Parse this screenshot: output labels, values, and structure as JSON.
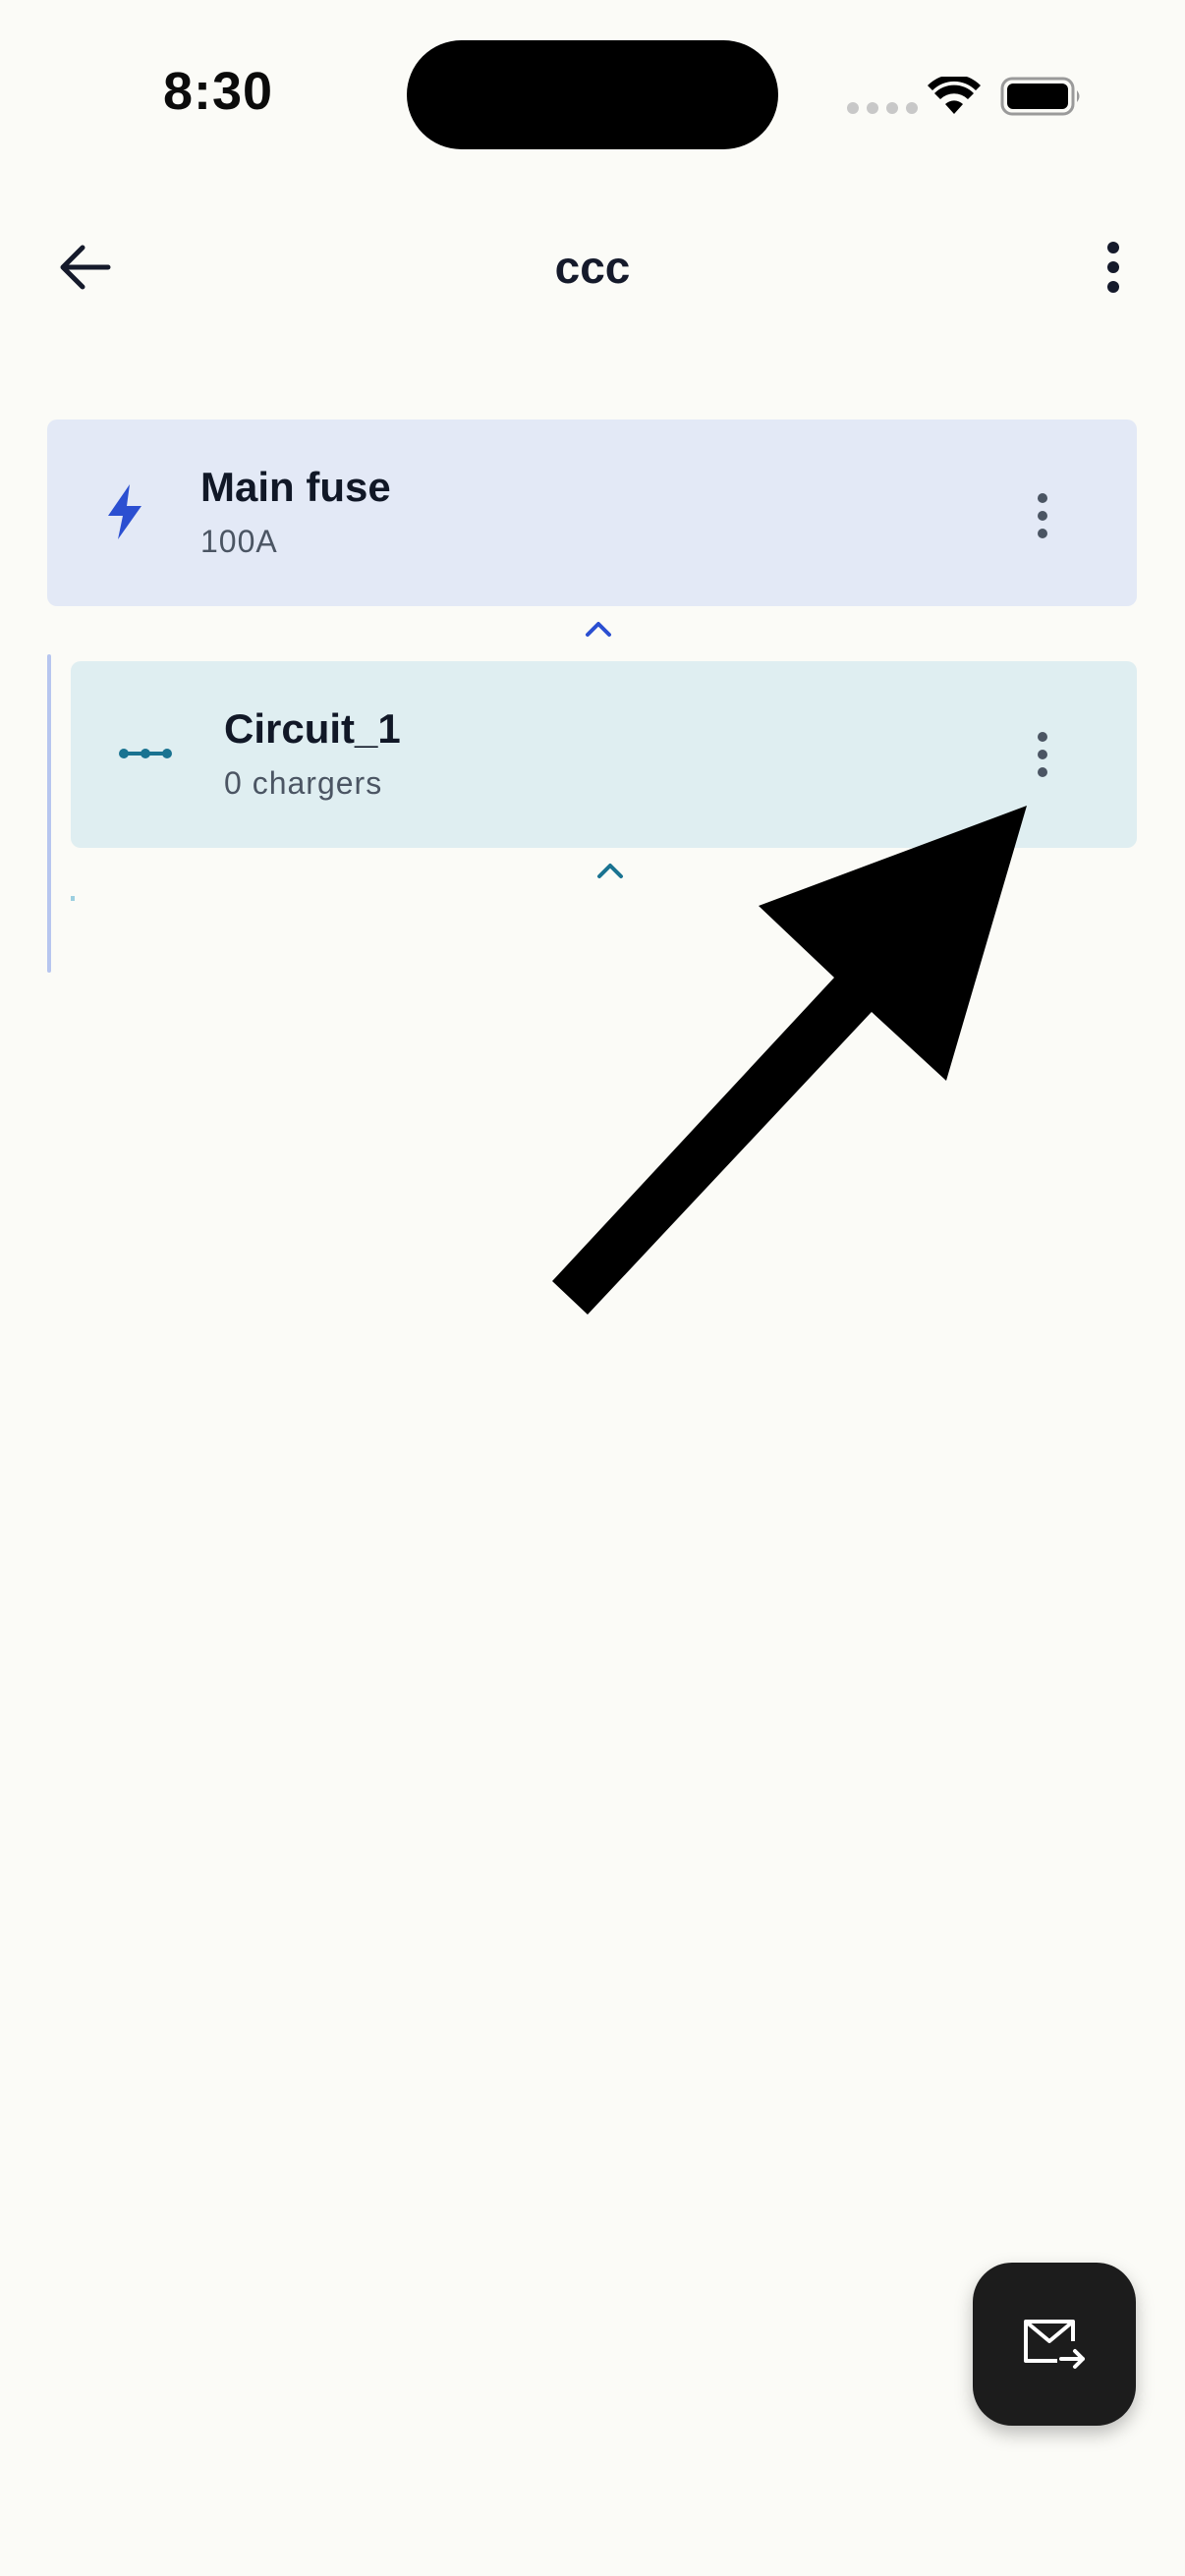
{
  "status_bar": {
    "time": "8:30"
  },
  "header": {
    "title": "ccc"
  },
  "main_fuse": {
    "title": "Main fuse",
    "rating": "100A"
  },
  "circuit": {
    "title": "Circuit_1",
    "chargers": "0 chargers"
  },
  "colors": {
    "background": "#fbfbf7",
    "fuse_card": "#e3e9f6",
    "circuit_card": "#dfeef1",
    "fuse_accent": "#2b4fd1",
    "circuit_accent": "#1a7391",
    "fab": "#1c1c1c"
  },
  "icons": {
    "back": "arrow-left-icon",
    "menu": "more-vertical-icon",
    "fuse": "lightning-icon",
    "circuit": "circuit-icon",
    "fab": "mail-forward-icon"
  }
}
